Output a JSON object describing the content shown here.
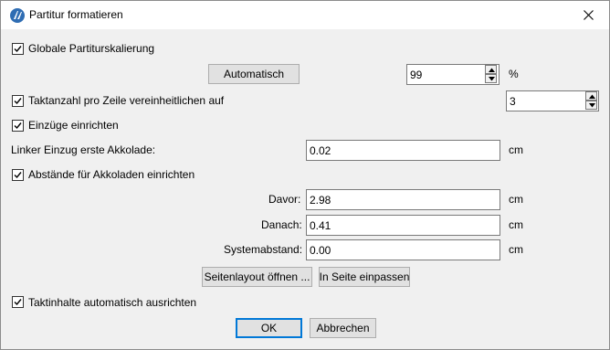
{
  "window": {
    "title": "Partitur formatieren",
    "close_symbol": "✕",
    "app_icon": "musescore-logo-icon"
  },
  "options": {
    "global_scaling": {
      "label": "Globale Partiturskalierung",
      "checked": true
    },
    "auto_button": "Automatisch",
    "scaling_value": "99",
    "scaling_unit": "%",
    "bars_per_line": {
      "label": "Taktanzahl pro Zeile vereinheitlichen auf",
      "checked": true
    },
    "bars_per_line_value": "3",
    "indents": {
      "label": "Einzüge einrichten",
      "checked": true
    },
    "left_indent_label": "Linker Einzug erste Akkolade:",
    "left_indent_value": "0.02",
    "left_indent_unit": "cm",
    "system_spacing": {
      "label": "Abstände für Akkoladen einrichten",
      "checked": true
    },
    "before_label": "Davor:",
    "before_value": "2.98",
    "before_unit": "cm",
    "after_label": "Danach:",
    "after_value": "0.41",
    "after_unit": "cm",
    "system_distance_label": "Systemabstand:",
    "system_distance_value": "0.00",
    "system_distance_unit": "cm",
    "page_layout_button": "Seitenlayout öffnen ...",
    "fit_page_button": "In Seite einpassen",
    "auto_align": {
      "label": "Taktinhalte automatisch ausrichten",
      "checked": true
    }
  },
  "footer": {
    "ok": "OK",
    "cancel": "Abbrechen"
  },
  "colors": {
    "background": "#f0f0f0",
    "titlebar": "#ffffff",
    "default_button_border": "#0078d7"
  }
}
